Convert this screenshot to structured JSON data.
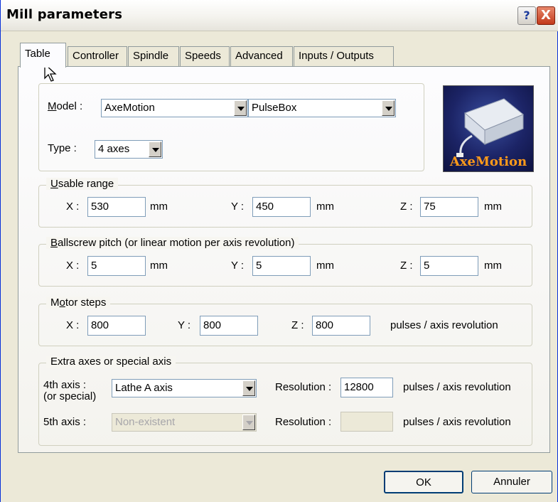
{
  "window": {
    "title": "Mill parameters"
  },
  "titlebar_buttons": {
    "help": "?",
    "close": "X"
  },
  "tabs": [
    {
      "label": "Table",
      "active": true
    },
    {
      "label": "Controller",
      "active": false
    },
    {
      "label": "Spindle",
      "active": false
    },
    {
      "label": "Speeds",
      "active": false
    },
    {
      "label": "Advanced",
      "active": false
    },
    {
      "label": "Inputs / Outputs",
      "active": false
    }
  ],
  "model": {
    "label_u": "M",
    "label_rest": "odel :",
    "controller_value": "AxeMotion",
    "device_value": "PulseBox"
  },
  "type": {
    "label": "Type :",
    "value": "4 axes"
  },
  "logo": {
    "text": "AxeMotion"
  },
  "usable_range": {
    "legend_u": "U",
    "legend_rest": "sable range",
    "x_label": "X :",
    "x_value": "530",
    "y_label": "Y :",
    "y_value": "450",
    "z_label": "Z :",
    "z_value": "75",
    "unit": "mm"
  },
  "ballscrew": {
    "legend_u": "B",
    "legend_rest": "allscrew pitch (or linear motion per axis revolution)",
    "x_label": "X :",
    "x_value": "5",
    "y_label": "Y :",
    "y_value": "5",
    "z_label": "Z :",
    "z_value": "5",
    "unit": "mm"
  },
  "motor_steps": {
    "legend_pre": "M",
    "legend_u": "o",
    "legend_rest": "tor steps",
    "x_label": "X :",
    "x_value": "800",
    "y_label": "Y :",
    "y_value": "800",
    "z_label": "Z :",
    "z_value": "800",
    "unit": "pulses / axis revolution"
  },
  "extra_axes": {
    "legend": "Extra axes or special axis",
    "axis4_label": "4th axis :",
    "axis4_sub": "(or special)",
    "axis4_value": "Lathe A axis",
    "axis4_resolution_label": "Resolution :",
    "axis4_resolution_value": "12800",
    "axis5_label": "5th axis :",
    "axis5_value": "Non-existent",
    "axis5_resolution_label": "Resolution :",
    "axis5_resolution_value": "",
    "unit": "pulses / axis revolution"
  },
  "buttons": {
    "ok": "OK",
    "cancel": "Annuler"
  }
}
